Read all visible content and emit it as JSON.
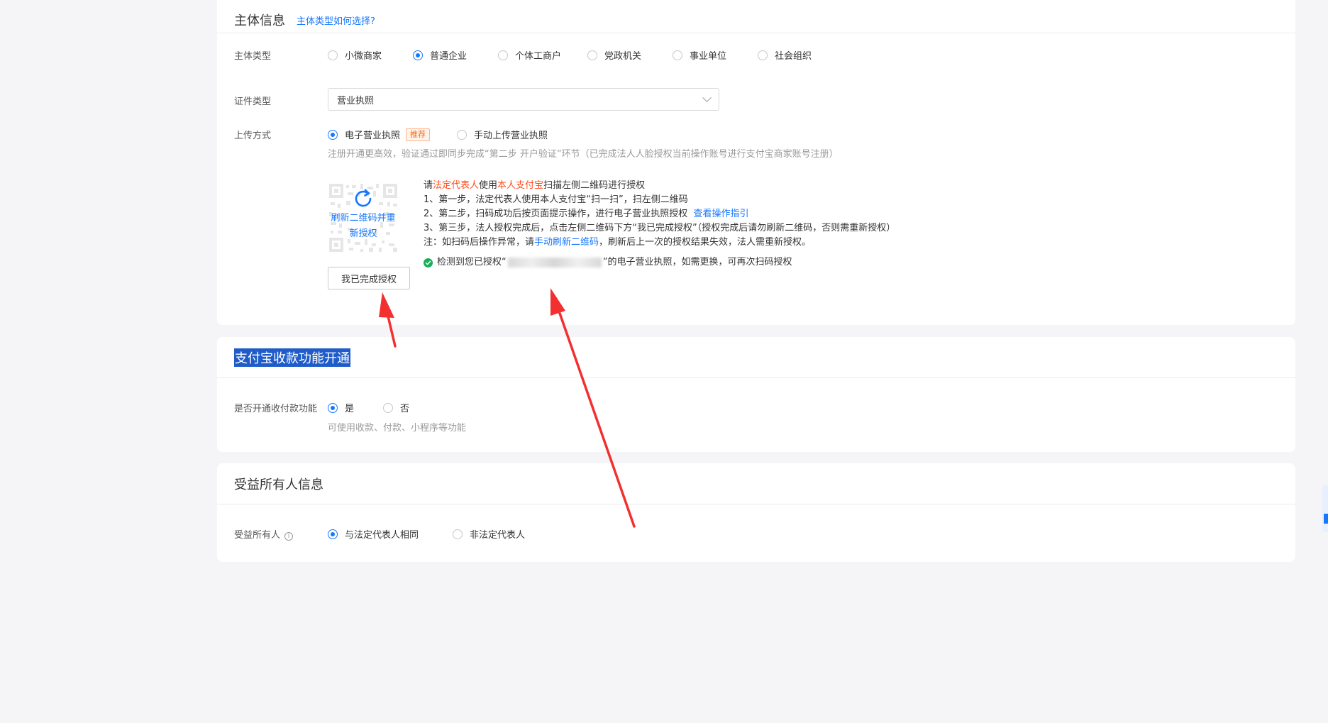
{
  "subject_section": {
    "title": "主体信息",
    "help_link": "主体类型如何选择?",
    "subject_type": {
      "label": "主体类型",
      "options": [
        "小微商家",
        "普通企业",
        "个体工商户",
        "党政机关",
        "事业单位",
        "社会组织"
      ],
      "selected": "普通企业"
    },
    "cert_type": {
      "label": "证件类型",
      "value": "营业执照"
    },
    "upload": {
      "label": "上传方式",
      "options": [
        "电子营业执照",
        "手动上传营业执照"
      ],
      "selected": "电子营业执照",
      "recommend_tag": "推荐",
      "hint": "注册开通更高效，验证通过即同步完成“第二步 开户验证”环节（已完成法人人脸授权当前操作账号进行支付宝商家账号注册）"
    },
    "qr": {
      "refresh_text": "刷新二维码并重新授权",
      "done_button": "我已完成授权"
    },
    "instructions": {
      "head_prefix": "请",
      "head_red1": "法定代表人",
      "head_mid": "使用",
      "head_red2": "本人支付宝",
      "head_suffix": "扫描左侧二维码进行授权",
      "step1": "1、第一步，法定代表人使用本人支付宝“扫一扫”，扫左侧二维码",
      "step2": "2、第二步，扫码成功后按页面提示操作，进行电子营业执照授权",
      "step2_link": "查看操作指引",
      "step3": "3、第三步，法人授权完成后，点击左侧二维码下方“我已完成授权”（授权完成后请勿刷新二维码，否则需重新授权）",
      "note_prefix": "注：如扫码后操作异常，请",
      "note_link": "手动刷新二维码",
      "note_suffix": "，刷新后上一次的授权结果失效，法人需重新授权。",
      "status_prefix": "检测到您已授权“",
      "status_suffix": "”的电子营业执照，如需更换，可再次扫码授权"
    }
  },
  "alipay_section": {
    "title": "支付宝收款功能开通",
    "label": "是否开通收付款功能",
    "options": [
      "是",
      "否"
    ],
    "selected": "是",
    "hint": "可使用收款、付款、小程序等功能"
  },
  "beneficiary_section": {
    "title": "受益所有人信息",
    "label": "受益所有人",
    "info_icon": "i",
    "options": [
      "与法定代表人相同",
      "非法定代表人"
    ],
    "selected": "与法定代表人相同"
  },
  "colors": {
    "accent": "#1677ff",
    "red": "#ff4d1f",
    "success": "#1aad5b",
    "annotation_arrow": "#f23030"
  }
}
